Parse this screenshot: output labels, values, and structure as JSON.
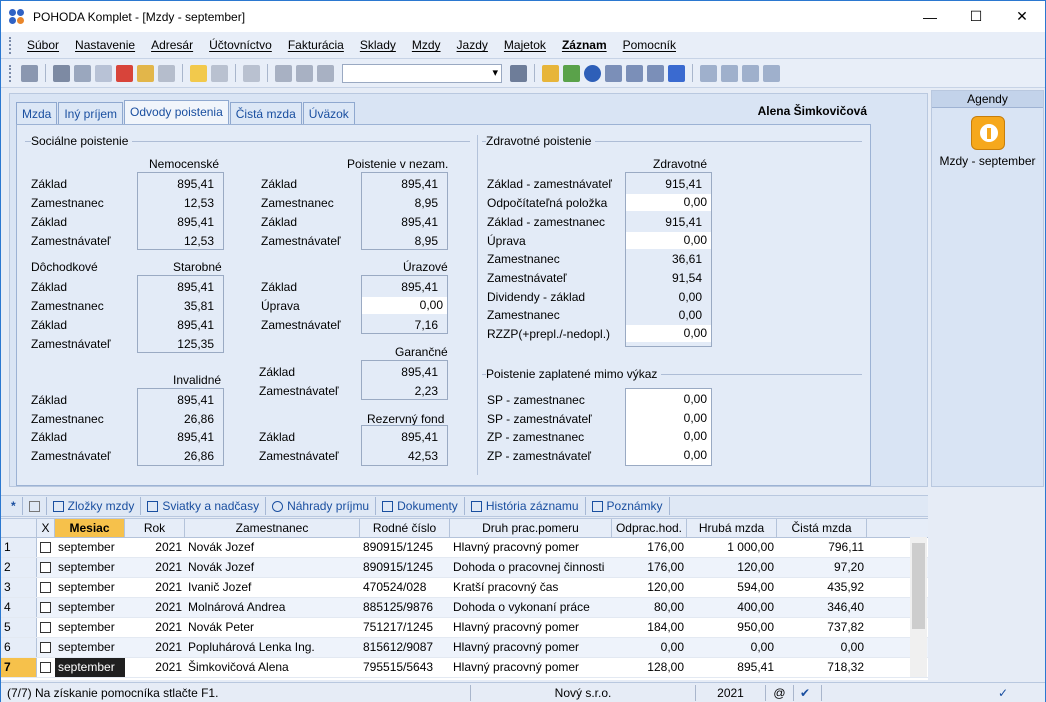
{
  "window": {
    "title": "POHODA Komplet - [Mzdy - september]",
    "minimize": "—",
    "maximize": "☐",
    "close": "✕"
  },
  "menu": [
    "Súbor",
    "Nastavenie",
    "Adresár",
    "Účtovníctvo",
    "Fakturácia",
    "Sklady",
    "Mzdy",
    "Jazdy",
    "Majetok",
    "Záznam",
    "Pomocník"
  ],
  "tabs": [
    "Mzda",
    "Iný príjem",
    "Odvody poistenia",
    "Čistá mzda",
    "Úväzok"
  ],
  "active_tab": "Odvody poistenia",
  "person_name": "Alena Šimkovičová",
  "social": {
    "title": "Sociálne poistenie",
    "nemocenske": {
      "title": "Nemocenské",
      "rows": [
        [
          "Základ",
          "895,41"
        ],
        [
          "Zamestnanec",
          "12,53"
        ],
        [
          "Základ",
          "895,41"
        ],
        [
          "Zamestnávateľ",
          "12,53"
        ]
      ]
    },
    "nezam": {
      "title": "Poistenie v nezam.",
      "rows": [
        [
          "Základ",
          "895,41"
        ],
        [
          "Zamestnanec",
          "8,95"
        ],
        [
          "Základ",
          "895,41"
        ],
        [
          "Zamestnávateľ",
          "8,95"
        ]
      ]
    },
    "dochodkove": "Dôchodkové",
    "starobne": {
      "title": "Starobné",
      "rows": [
        [
          "Základ",
          "895,41"
        ],
        [
          "Zamestnanec",
          "35,81"
        ],
        [
          "Základ",
          "895,41"
        ],
        [
          "Zamestnávateľ",
          "125,35"
        ]
      ]
    },
    "urazove": {
      "title": "Úrazové",
      "rows": [
        [
          "Základ",
          "895,41"
        ],
        [
          "Úprava",
          "0,00"
        ],
        [
          "Zamestnávateľ",
          "7,16"
        ]
      ]
    },
    "garancne": {
      "title": "Garančné",
      "rows": [
        [
          "Základ",
          "895,41"
        ],
        [
          "Zamestnávateľ",
          "2,23"
        ]
      ]
    },
    "invalidne": {
      "title": "Invalidné",
      "rows": [
        [
          "Základ",
          "895,41"
        ],
        [
          "Zamestnanec",
          "26,86"
        ],
        [
          "Základ",
          "895,41"
        ],
        [
          "Zamestnávateľ",
          "26,86"
        ]
      ]
    },
    "rezervny": {
      "title": "Rezervný fond",
      "rows": [
        [
          "Základ",
          "895,41"
        ],
        [
          "Zamestnávateľ",
          "42,53"
        ]
      ]
    }
  },
  "health": {
    "title": "Zdravotné poistenie",
    "col_title": "Zdravotné",
    "rows": [
      [
        "Základ - zamestnávateľ",
        "915,41"
      ],
      [
        "Odpočítateľná položka",
        "0,00"
      ],
      [
        "Základ - zamestnanec",
        "915,41"
      ],
      [
        "Úprava",
        "0,00"
      ],
      [
        "Zamestnanec",
        "36,61"
      ],
      [
        "Zamestnávateľ",
        "91,54"
      ],
      [
        "Dividendy - základ",
        "0,00"
      ],
      [
        "Zamestnanec",
        "0,00"
      ],
      [
        "RZZP(+prepl./-nedopl.)",
        "0,00"
      ]
    ]
  },
  "outside": {
    "title": "Poistenie zaplatené mimo výkaz",
    "rows": [
      [
        "SP - zamestnanec",
        "0,00"
      ],
      [
        "SP - zamestnávateľ",
        "0,00"
      ],
      [
        "ZP - zamestnanec",
        "0,00"
      ],
      [
        "ZP - zamestnávateľ",
        "0,00"
      ]
    ]
  },
  "agendy": {
    "title": "Agendy",
    "item": "Mzdy - september"
  },
  "bottom_tabs": [
    "Zložky mzdy",
    "Sviatky a nadčasy",
    "Náhrady príjmu",
    "Dokumenty",
    "História záznamu",
    "Poznámky"
  ],
  "grid": {
    "headers": [
      "X",
      "Mesiac",
      "Rok",
      "Zamestnanec",
      "Rodné číslo",
      "Druh prac.pomeru",
      "Odprac.hod.",
      "Hrubá mzda",
      "Čistá mzda"
    ],
    "rows": [
      [
        "1",
        "september",
        "2021",
        "Novák Jozef",
        "890915/1245",
        "Hlavný pracovný pomer",
        "176,00",
        "1 000,00",
        "796,11"
      ],
      [
        "2",
        "september",
        "2021",
        "Novák Jozef",
        "890915/1245",
        "Dohoda o pracovnej činnosti",
        "176,00",
        "120,00",
        "97,20"
      ],
      [
        "3",
        "september",
        "2021",
        "Ivanič Jozef",
        "470524/028",
        "Kratší pracovný čas",
        "120,00",
        "594,00",
        "435,92"
      ],
      [
        "4",
        "september",
        "2021",
        "Molnárová Andrea",
        "885125/9876",
        "Dohoda o vykonaní práce",
        "80,00",
        "400,00",
        "346,40"
      ],
      [
        "5",
        "september",
        "2021",
        "Novák Peter",
        "751217/1245",
        "Hlavný pracovný pomer",
        "184,00",
        "950,00",
        "737,82"
      ],
      [
        "6",
        "september",
        "2021",
        "Popluhárová Lenka Ing.",
        "815612/9087",
        "Hlavný pracovný pomer",
        "0,00",
        "0,00",
        "0,00"
      ],
      [
        "7",
        "september",
        "2021",
        "Šimkovičová Alena",
        "795515/5643",
        "Hlavný pracovný pomer",
        "128,00",
        "895,41",
        "718,32"
      ]
    ]
  },
  "status": {
    "hint": "(7/7) Na získanie pomocníka stlačte F1.",
    "company": "Nový s.r.o.",
    "year": "2021",
    "at": "@"
  }
}
